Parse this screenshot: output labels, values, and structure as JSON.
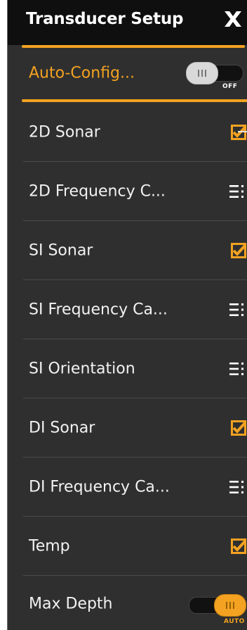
{
  "header": {
    "title": "Transducer Setup",
    "close_icon": "close-x-icon"
  },
  "auto_config": {
    "label": "Auto-Config...",
    "toggle_state": "OFF",
    "enabled": false
  },
  "items": [
    {
      "label": "2D Sonar",
      "control": "checkbox",
      "checked": true
    },
    {
      "label": "2D Frequency C...",
      "control": "menu"
    },
    {
      "label": "SI Sonar",
      "control": "checkbox",
      "checked": true
    },
    {
      "label": "SI Frequency Ca...",
      "control": "menu"
    },
    {
      "label": "SI Orientation",
      "control": "menu"
    },
    {
      "label": "DI Sonar",
      "control": "checkbox",
      "checked": true
    },
    {
      "label": "DI Frequency Ca...",
      "control": "menu"
    },
    {
      "label": "Temp",
      "control": "checkbox",
      "checked": true
    }
  ],
  "max_depth": {
    "label": "Max Depth",
    "toggle_state": "AUTO",
    "enabled": true
  },
  "colors": {
    "accent": "#f3a221",
    "panel": "#2f2f2f",
    "header": "#0f0f0f",
    "text": "#f2f2f2"
  }
}
